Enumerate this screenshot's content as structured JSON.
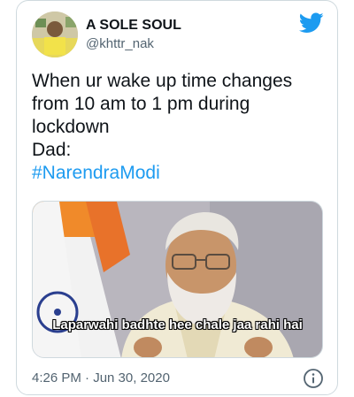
{
  "user": {
    "display_name": "A SOLE SOUL",
    "handle": "@khttr_nak",
    "avatar_icon": "profile-photo"
  },
  "brand": {
    "icon": "twitter-bird-icon",
    "color": "#1d9bf0"
  },
  "tweet": {
    "lines": [
      "When ur wake up time changes",
      "from 10 am to 1 pm during",
      "lockdown",
      "Dad:"
    ],
    "hashtag": "#NarendraModi",
    "media_caption": "Laparwahi badhte hee chale jaa rahi hai",
    "timestamp": "4:26 PM · Jun 30, 2020",
    "info_icon": "info-icon"
  },
  "colors": {
    "text": "#0f1419",
    "secondary": "#536471",
    "link": "#1d9bf0",
    "border": "#cfd9de"
  }
}
